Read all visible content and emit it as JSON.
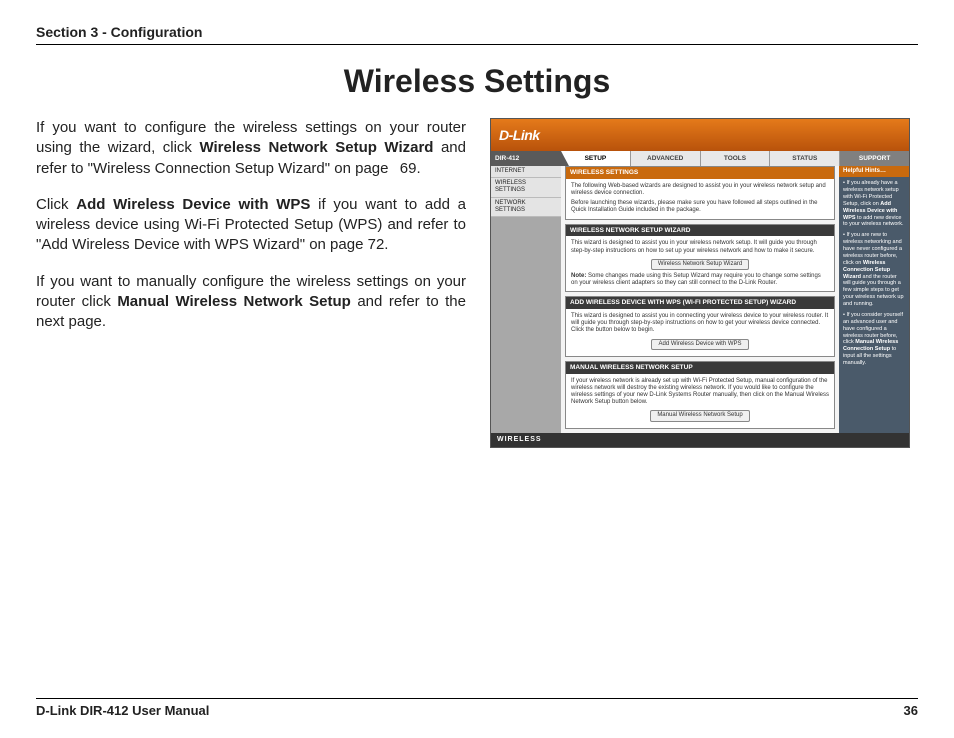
{
  "header": {
    "section": "Section 3 - Configuration"
  },
  "title": "Wireless Settings",
  "body": {
    "p1a": "If you want to configure the wireless settings on your router using the wizard, click ",
    "p1b": "Wireless Network Setup Wizard",
    "p1c": " and refer to \"Wireless Connection Setup Wizard\" on page ",
    "p1d": "69.",
    "p2a": "Click ",
    "p2b": "Add Wireless Device with WPS",
    "p2c": " if you want to add a wireless device using Wi-Fi Protected Setup (WPS) and refer to \"Add Wireless Device with WPS Wizard\" on page 72.",
    "p3a": "If you want to manually configure the wireless settings on your router click ",
    "p3b": "Manual Wireless Network Setup",
    "p3c": " and refer to the next page."
  },
  "router": {
    "logo": "D-Link",
    "model": "DIR-412",
    "tabs": {
      "setup": "SETUP",
      "advanced": "ADVANCED",
      "tools": "TOOLS",
      "status": "STATUS",
      "support": "SUPPORT"
    },
    "side": {
      "internet": "INTERNET",
      "wireless": "WIRELESS SETTINGS",
      "network": "NETWORK SETTINGS"
    },
    "settings": {
      "h": "WIRELESS SETTINGS",
      "text1": "The following Web-based wizards are designed to assist you in your wireless network setup and wireless device connection.",
      "text2": "Before launching these wizards, please make sure you have followed all steps outlined in the Quick Installation Guide included in the package."
    },
    "wiz": {
      "h": "WIRELESS NETWORK SETUP WIZARD",
      "text": "This wizard is designed to assist you in your wireless network setup. It will guide you through step-by-step instructions on how to set up your wireless network and how to make it secure.",
      "btn": "Wireless Network Setup Wizard",
      "note_b": "Note:",
      "note": " Some changes made using this Setup Wizard may require you to change some settings on your wireless client adapters so they can still connect to the D-Link Router."
    },
    "wps": {
      "h": "ADD WIRELESS DEVICE WITH WPS (WI-FI PROTECTED SETUP) WIZARD",
      "text": "This wizard is designed to assist you in connecting your wireless device to your wireless router. It will guide you through step-by-step instructions on how to get your wireless device connected. Click the button below to begin.",
      "btn": "Add Wireless Device with WPS"
    },
    "manual": {
      "h": "MANUAL WIRELESS NETWORK SETUP",
      "text": "If your wireless network is already set up with Wi-Fi Protected Setup, manual configuration of the wireless network will destroy the existing wireless network. If you would like to configure the wireless settings of your new D-Link Systems Router manually, then click on the Manual Wireless Network Setup button below.",
      "btn": "Manual Wireless Network Setup"
    },
    "help": {
      "h": "Helpful Hints…",
      "b1a": "• If you already have a wireless network setup with Wi-Fi Protected Setup, click on ",
      "b1b": "Add Wireless Device with WPS",
      "b1c": " to add new device to your wireless network.",
      "b2a": "• If you are new to wireless networking and have never configured a wireless router before, click on ",
      "b2b": "Wireless Connection Setup Wizard",
      "b2c": " and the router will guide you through a few simple steps to get your wireless network up and running.",
      "b3a": "• If you consider yourself an advanced user and have configured a wireless router before, click ",
      "b3b": "Manual Wireless Connection Setup",
      "b3c": " to input all the settings manually."
    },
    "footer": "WIRELESS"
  },
  "footer": {
    "left": "D-Link DIR-412 User Manual",
    "right": "36"
  }
}
